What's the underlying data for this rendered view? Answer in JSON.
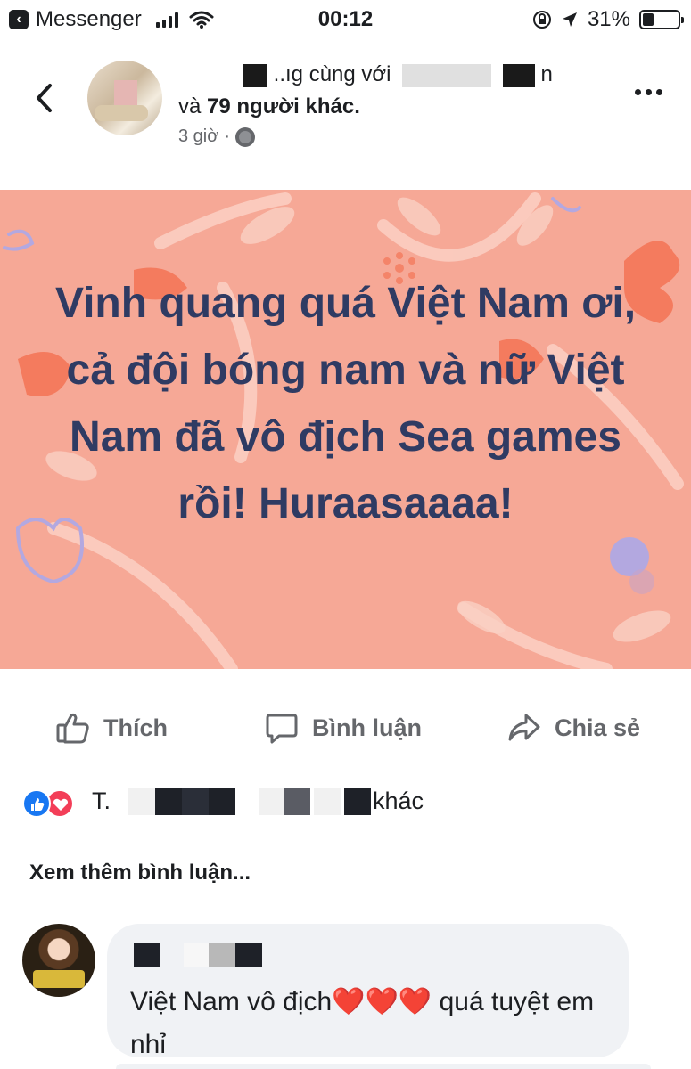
{
  "status_bar": {
    "app_name": "Messenger",
    "time": "00:12",
    "battery_percent": "31%",
    "battery_level": 0.31
  },
  "post": {
    "author_line1_fragment_a": "..ıg cùng với",
    "author_line1_fragment_b": "n",
    "author_line2_prefix": "và",
    "author_line2_bold": "79 người khác.",
    "time": "3 giờ",
    "separator": "·",
    "text": "Vinh quang quá Việt Nam ơi, cả đội bóng nam và nữ Việt Nam đã vô địch Sea games rồi! Huraasaaaa!",
    "background_color": "#f6a896",
    "text_color": "#2f3b63"
  },
  "actions": {
    "like": "Thích",
    "comment": "Bình luận",
    "share": "Chia sẻ"
  },
  "reactions": {
    "prefix": "T.",
    "suffix": "khác",
    "icons": [
      "like-icon",
      "love-icon"
    ]
  },
  "comments": {
    "see_more": "Xem thêm bình luận...",
    "items": [
      {
        "text_before": "Việt Nam vô địch",
        "hearts": "❤️❤️❤️",
        "text_after": " quá tuyệt em nhỉ"
      }
    ]
  }
}
